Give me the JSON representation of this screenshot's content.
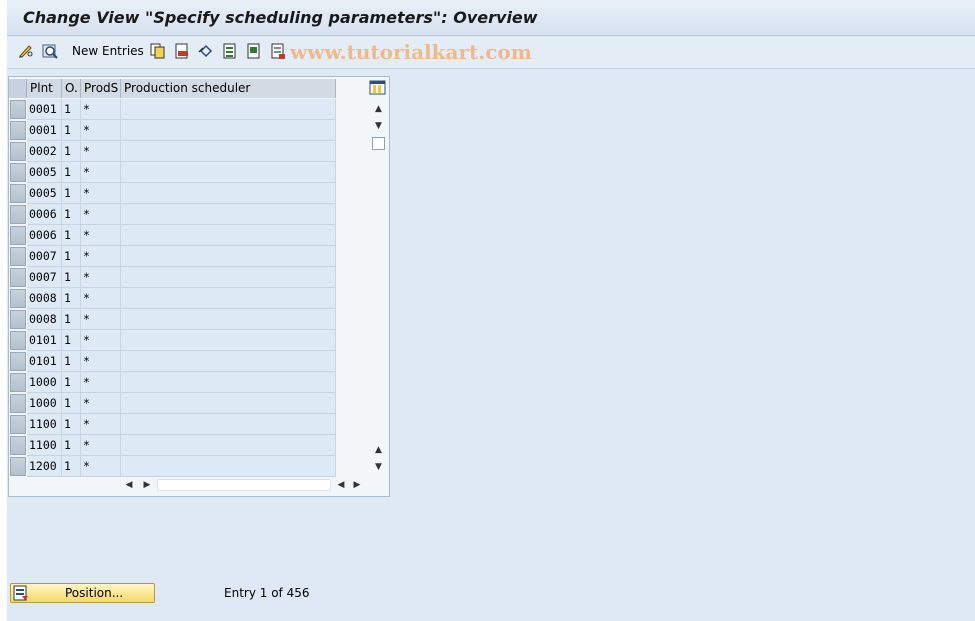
{
  "window": {
    "title": "Change View \"Specify scheduling parameters\": Overview"
  },
  "toolbar": {
    "new_entries_label": "New Entries",
    "watermark": "www.tutorialkart.com",
    "icons": [
      "pencil-glasses-icon",
      "other-view-icon",
      "copy-icon",
      "delete-icon",
      "undo-icon",
      "select-all-icon",
      "select-block-icon",
      "deselect-all-icon"
    ]
  },
  "table": {
    "columns": [
      "Plnt",
      "O.",
      "ProdS",
      "Production scheduler"
    ],
    "rows": [
      {
        "plnt": "0001",
        "o": "1",
        "prods": "*",
        "scheduler": ""
      },
      {
        "plnt": "0001",
        "o": "1",
        "prods": "*",
        "scheduler": ""
      },
      {
        "plnt": "0002",
        "o": "1",
        "prods": "*",
        "scheduler": ""
      },
      {
        "plnt": "0005",
        "o": "1",
        "prods": "*",
        "scheduler": ""
      },
      {
        "plnt": "0005",
        "o": "1",
        "prods": "*",
        "scheduler": ""
      },
      {
        "plnt": "0006",
        "o": "1",
        "prods": "*",
        "scheduler": ""
      },
      {
        "plnt": "0006",
        "o": "1",
        "prods": "*",
        "scheduler": ""
      },
      {
        "plnt": "0007",
        "o": "1",
        "prods": "*",
        "scheduler": ""
      },
      {
        "plnt": "0007",
        "o": "1",
        "prods": "*",
        "scheduler": ""
      },
      {
        "plnt": "0008",
        "o": "1",
        "prods": "*",
        "scheduler": ""
      },
      {
        "plnt": "0008",
        "o": "1",
        "prods": "*",
        "scheduler": ""
      },
      {
        "plnt": "0101",
        "o": "1",
        "prods": "*",
        "scheduler": ""
      },
      {
        "plnt": "0101",
        "o": "1",
        "prods": "*",
        "scheduler": ""
      },
      {
        "plnt": "1000",
        "o": "1",
        "prods": "*",
        "scheduler": ""
      },
      {
        "plnt": "1000",
        "o": "1",
        "prods": "*",
        "scheduler": ""
      },
      {
        "plnt": "1100",
        "o": "1",
        "prods": "*",
        "scheduler": ""
      },
      {
        "plnt": "1100",
        "o": "1",
        "prods": "*",
        "scheduler": ""
      },
      {
        "plnt": "1200",
        "o": "1",
        "prods": "*",
        "scheduler": ""
      }
    ]
  },
  "footer": {
    "position_button_label": "Position...",
    "entry_info": "Entry 1 of 456"
  },
  "colors": {
    "background": "#dfe9f5",
    "cell_bg": "#dde9f4",
    "button_yellow": "#f5d86a"
  }
}
